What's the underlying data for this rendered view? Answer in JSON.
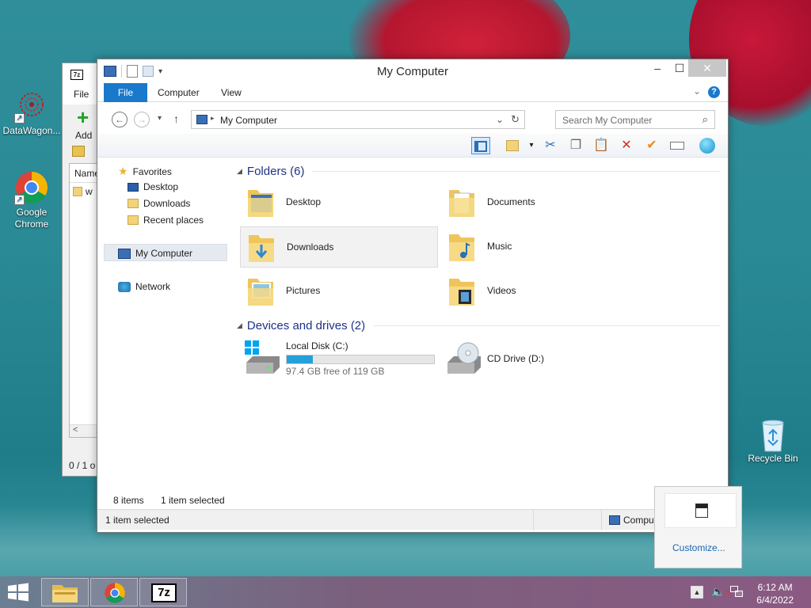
{
  "desktop": {
    "icons": [
      {
        "label": "DataWagon..."
      },
      {
        "label": "Google Chrome"
      },
      {
        "label": "Recycle Bin"
      }
    ]
  },
  "bg_window": {
    "logo": "7z",
    "menu_file": "File",
    "tool_add": "Add",
    "col_name": "Name",
    "row_item": "w",
    "status": "0 / 1 o"
  },
  "explorer": {
    "title": "My Computer",
    "tabs": {
      "file": "File",
      "computer": "Computer",
      "view": "View"
    },
    "address": "My Computer",
    "search_placeholder": "Search My Computer",
    "nav": {
      "favorites": "Favorites",
      "desktop": "Desktop",
      "downloads": "Downloads",
      "recent": "Recent places",
      "my_computer": "My Computer",
      "network": "Network"
    },
    "folders_group": "Folders (6)",
    "folders": [
      {
        "name": "Desktop"
      },
      {
        "name": "Documents"
      },
      {
        "name": "Downloads"
      },
      {
        "name": "Music"
      },
      {
        "name": "Pictures"
      },
      {
        "name": "Videos"
      }
    ],
    "drives_group": "Devices and drives (2)",
    "drives": [
      {
        "name": "Local Disk (C:)",
        "free_text": "97.4 GB free of 119 GB",
        "used_fraction": 0.18
      },
      {
        "name": "CD Drive (D:)"
      }
    ],
    "status": {
      "items": "8 items",
      "selected": "1 item selected",
      "bottom_selected": "1 item selected",
      "bottom_right": "Compu"
    }
  },
  "tray_popup": {
    "customize": "Customize..."
  },
  "taskbar": {
    "time": "6:12 AM",
    "date": "6/4/2022",
    "app_7z": "7z"
  },
  "colors": {
    "accent": "#1979ca",
    "progress": "#26a0da",
    "group_header": "#1e3287"
  }
}
